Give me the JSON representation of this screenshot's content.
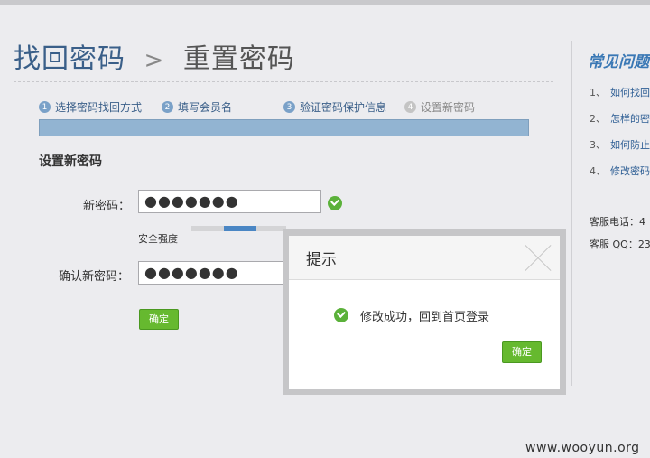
{
  "page": {
    "title_part1": "找回密码",
    "title_separator": ">",
    "title_part2": "重置密码"
  },
  "steps": [
    {
      "num": "1",
      "label": "选择密码找回方式"
    },
    {
      "num": "2",
      "label": "填写会员名"
    },
    {
      "num": "3",
      "label": "验证密码保护信息"
    },
    {
      "num": "4",
      "label": "设置新密码"
    }
  ],
  "form": {
    "section_title": "设置新密码",
    "new_password_label": "新密码：",
    "new_password_value": "●●●●●●●",
    "strength_label": "安全强度",
    "strength_level": 0.35,
    "confirm_password_label": "确认新密码：",
    "confirm_password_value": "●●●●●●●",
    "submit_label": "确定"
  },
  "sidebar": {
    "faq_title": "常见问题",
    "faq": [
      {
        "num": "1、",
        "text": "如何找回"
      },
      {
        "num": "2、",
        "text": "怎样的密"
      },
      {
        "num": "3、",
        "text": "如何防止"
      },
      {
        "num": "4、",
        "text": "修改密码"
      }
    ],
    "service_phone": "客服电话：4",
    "service_qq": "客服 QQ：23"
  },
  "dialog": {
    "title": "提示",
    "message": "修改成功，回到首页登录",
    "ok_label": "确定"
  },
  "watermark": "www.wooyun.org",
  "colors": {
    "accent": "#3a5f89",
    "progress": "#92b4d2",
    "button": "#66b92f",
    "success": "#5bb13a"
  },
  "icons": {
    "close": "close-icon",
    "success": "check-circle-icon"
  }
}
